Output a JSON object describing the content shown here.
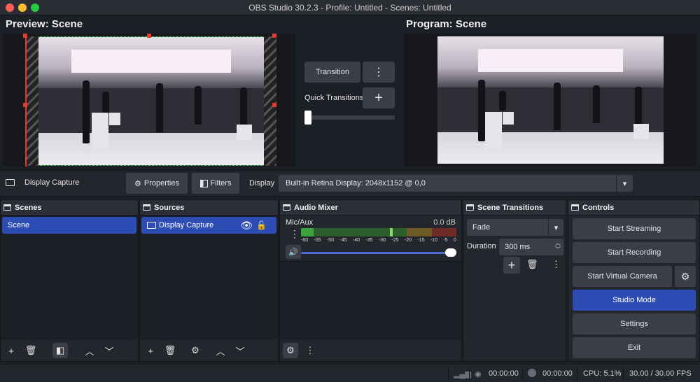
{
  "window": {
    "title": "OBS Studio 30.2.3 - Profile: Untitled - Scenes: Untitled"
  },
  "preview": {
    "label": "Preview: Scene"
  },
  "program": {
    "label": "Program: Scene"
  },
  "transitions_panel": {
    "transition_label": "Transition",
    "quick_transitions_label": "Quick Transitions",
    "more_icon": "vertical-dots",
    "add_icon": "plus"
  },
  "context_bar": {
    "source_name": "Display Capture",
    "properties_label": "Properties",
    "filters_label": "Filters",
    "display_label": "Display",
    "display_value": "Built-in Retina Display: 2048x1152 @ 0,0"
  },
  "scenes": {
    "title": "Scenes",
    "items": [
      "Scene"
    ],
    "selected": "Scene"
  },
  "sources": {
    "title": "Sources",
    "items": [
      {
        "name": "Display Capture",
        "visible": true,
        "locked": false
      }
    ]
  },
  "audio_mixer": {
    "title": "Audio Mixer",
    "channel": "Mic/Aux",
    "level": "0.0 dB",
    "ticks": [
      "-60",
      "-55",
      "-50",
      "-45",
      "-40",
      "-35",
      "-30",
      "-25",
      "-20",
      "-15",
      "-10",
      "-5",
      "0"
    ]
  },
  "scene_transitions": {
    "title": "Scene Transitions",
    "transition": "Fade",
    "duration_label": "Duration",
    "duration_value": "300 ms"
  },
  "controls": {
    "title": "Controls",
    "start_streaming": "Start Streaming",
    "start_recording": "Start Recording",
    "start_virtual_camera": "Start Virtual Camera",
    "studio_mode": "Studio Mode",
    "settings": "Settings",
    "exit": "Exit"
  },
  "status": {
    "stream_time": "00:00:00",
    "record_time": "00:00:00",
    "cpu": "CPU: 5.1%",
    "fps": "30.00 / 30.00 FPS"
  },
  "colors": {
    "accent": "#2d4db4",
    "meter_green": "#3ea53e",
    "meter_yellow": "#b8a23a",
    "meter_red": "#c4443a"
  }
}
